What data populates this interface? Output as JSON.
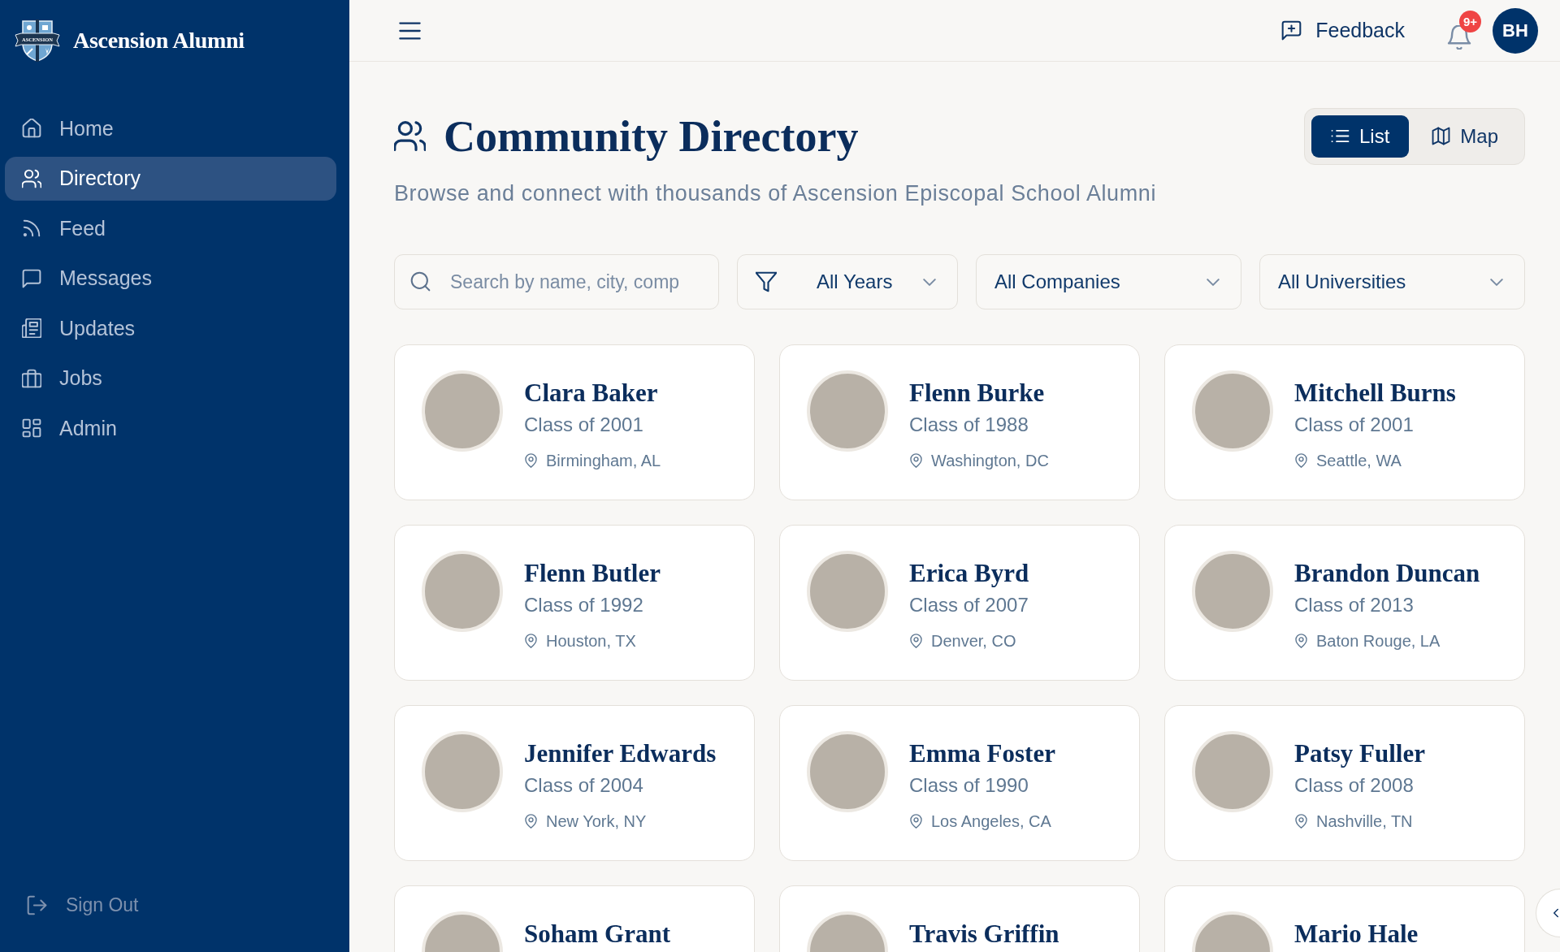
{
  "sidebar": {
    "brand": {
      "crest_banner": "ASCENSION",
      "name": "Ascension Alumni"
    },
    "nav": [
      {
        "label": "Home",
        "selected": false
      },
      {
        "label": "Directory",
        "selected": true
      },
      {
        "label": "Feed",
        "selected": false
      },
      {
        "label": "Messages",
        "selected": false
      },
      {
        "label": "Updates",
        "selected": false
      },
      {
        "label": "Jobs",
        "selected": false
      },
      {
        "label": "Admin",
        "selected": false
      }
    ],
    "sign_out": "Sign Out"
  },
  "header": {
    "feedback": "Feedback",
    "notification_badge": "9+",
    "avatar_initials": "BH"
  },
  "page": {
    "title": "Community Directory",
    "subtitle": "Browse and connect with thousands of Ascension Episcopal School Alumni",
    "view_toggle": [
      {
        "label": "List",
        "selected": true
      },
      {
        "label": "Map",
        "selected": false
      }
    ]
  },
  "filters": {
    "search": {
      "placeholder": "Search by name, city, comp"
    },
    "year_filter": {
      "value": "All Years"
    },
    "company_filter": {
      "value": "All Companies"
    },
    "university_filter": {
      "value": "All Universities"
    }
  },
  "directory": [
    {
      "name": "Clara Baker",
      "class": "Class of 2001",
      "location": "Birmingham, AL"
    },
    {
      "name": "Flenn Burke",
      "class": "Class of 1988",
      "location": "Washington, DC"
    },
    {
      "name": "Mitchell Burns",
      "class": "Class of 2001",
      "location": "Seattle, WA"
    },
    {
      "name": "Flenn Butler",
      "class": "Class of 1992",
      "location": "Houston, TX"
    },
    {
      "name": "Erica Byrd",
      "class": "Class of 2007",
      "location": "Denver, CO"
    },
    {
      "name": "Brandon Duncan",
      "class": "Class of 2013",
      "location": "Baton Rouge, LA"
    },
    {
      "name": "Jennifer Edwards",
      "class": "Class of 2004",
      "location": "New York, NY"
    },
    {
      "name": "Emma Foster",
      "class": "Class of 1990",
      "location": "Los Angeles, CA"
    },
    {
      "name": "Patsy Fuller",
      "class": "Class of 2008",
      "location": "Nashville, TN"
    },
    {
      "name": "Soham Grant"
    },
    {
      "name": "Travis Griffin"
    },
    {
      "name": "Mario Hale"
    }
  ]
}
